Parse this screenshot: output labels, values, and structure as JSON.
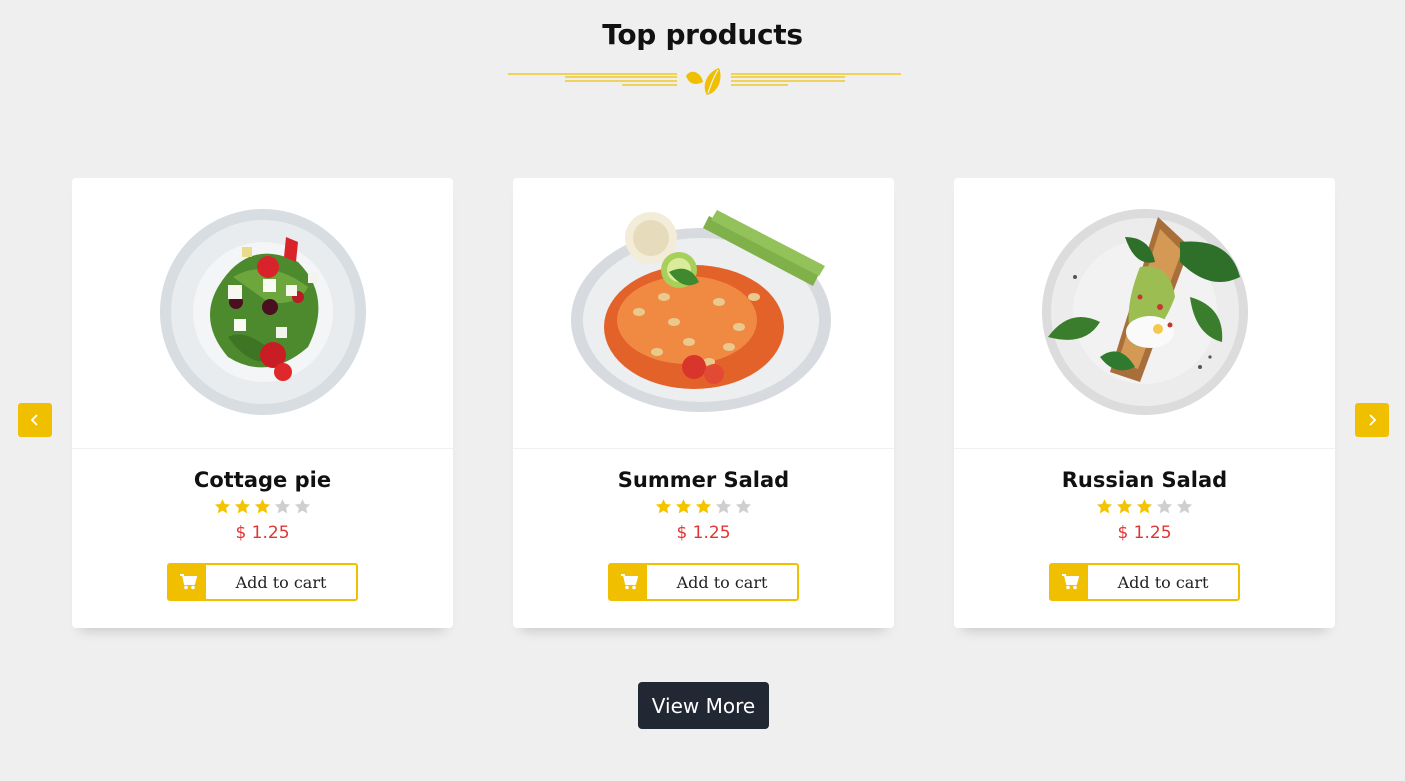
{
  "section": {
    "title": "Top products"
  },
  "products": [
    {
      "name": "Cottage pie",
      "price": "$ 1.25",
      "rating": 3,
      "rating_max": 5,
      "cart_label": "Add to cart"
    },
    {
      "name": "Summer Salad",
      "price": "$ 1.25",
      "rating": 3,
      "rating_max": 5,
      "cart_label": "Add to cart"
    },
    {
      "name": "Russian Salad",
      "price": "$ 1.25",
      "rating": 3,
      "rating_max": 5,
      "cart_label": "Add to cart"
    }
  ],
  "actions": {
    "view_more_label": "View More"
  },
  "icons": {
    "prev": "chevron-left-icon",
    "next": "chevron-right-icon",
    "cart": "cart-icon",
    "divider": "leaf-icon",
    "star": "star-icon"
  },
  "colors": {
    "accent": "#f0c000",
    "price": "#e03535",
    "star_filled": "#f5c400",
    "star_empty": "#cfcfcf",
    "button_dark": "#212834",
    "background": "#efefef"
  }
}
